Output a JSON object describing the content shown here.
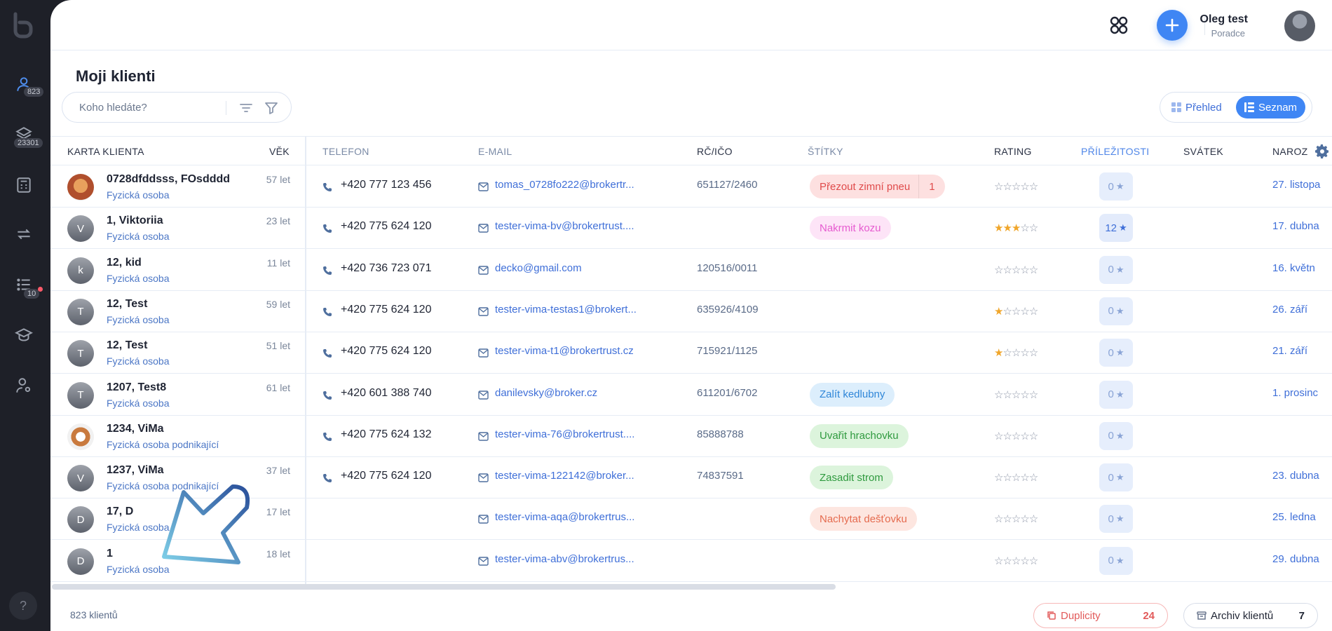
{
  "sidebar": {
    "clients_badge": "823",
    "products_badge": "23301",
    "tasks_badge": "10",
    "help_label": "?"
  },
  "topbar": {
    "user_name": "Oleg test",
    "user_role": "Poradce"
  },
  "page": {
    "title": "Moji klienti",
    "search_placeholder": "Koho hledáte?",
    "view_prehled": "Přehled",
    "view_seznam": "Seznam"
  },
  "columns": {
    "karta": "KARTA KLIENTA",
    "vek": "VĚK",
    "telefon": "TELEFON",
    "email": "E-MAIL",
    "rc": "RČ/IČO",
    "stitky": "ŠTÍTKY",
    "rating": "RATING",
    "prilezitosti": "PŘÍLEŽITOSTI",
    "svatek": "SVÁTEK",
    "narozeniny": "NAROZ"
  },
  "rows": [
    {
      "name": "0728dfddsss, FOsdddd",
      "type": "Fyzická osoba",
      "age": "57 let",
      "avatar": "",
      "phone": "+420 777 123 456",
      "email": "tomas_0728fo222@brokertr...",
      "rc": "651127/2460",
      "tag": "Přezout zimní pneu",
      "tag_extra": "1",
      "tag_bg": "#fde0e0",
      "tag_fg": "#e04b4b",
      "rating": 0,
      "opp": "0",
      "bday": "27. listopa"
    },
    {
      "name": "1, Viktoriia",
      "type": "Fyzická osoba",
      "age": "23 let",
      "avatar": "V",
      "phone": "+420 775 624 120",
      "email": "tester-vima-bv@brokertrust....",
      "rc": "",
      "tag": "Nakrmit kozu",
      "tag_extra": "",
      "tag_bg": "#fde4f7",
      "tag_fg": "#e65bd0",
      "rating": 3,
      "opp": "12",
      "bday": "17. dubna"
    },
    {
      "name": "12, kid",
      "type": "Fyzická osoba",
      "age": "11 let",
      "avatar": "k",
      "phone": "+420 736 723 071",
      "email": "decko@gmail.com",
      "rc": "120516/0011",
      "tag": "",
      "tag_extra": "",
      "tag_bg": "",
      "tag_fg": "",
      "rating": 0,
      "opp": "0",
      "bday": "16. květn"
    },
    {
      "name": "12, Test",
      "type": "Fyzická osoba",
      "age": "59 let",
      "avatar": "T",
      "phone": "+420 775 624 120",
      "email": "tester-vima-testas1@brokert...",
      "rc": "635926/4109",
      "tag": "",
      "tag_extra": "",
      "tag_bg": "",
      "tag_fg": "",
      "rating": 1,
      "opp": "0",
      "bday": "26. září"
    },
    {
      "name": "12, Test",
      "type": "Fyzická osoba",
      "age": "51 let",
      "avatar": "T",
      "phone": "+420 775 624 120",
      "email": "tester-vima-t1@brokertrust.cz",
      "rc": "715921/1125",
      "tag": "",
      "tag_extra": "",
      "tag_bg": "",
      "tag_fg": "",
      "rating": 1,
      "opp": "0",
      "bday": "21. září"
    },
    {
      "name": "1207, Test8",
      "type": "Fyzická osoba",
      "age": "61 let",
      "avatar": "T",
      "phone": "+420 601 388 740",
      "email": "danilevsky@broker.cz",
      "rc": "611201/6702",
      "tag": "Zalít kedlubny",
      "tag_extra": "",
      "tag_bg": "#dceefc",
      "tag_fg": "#2f86d8",
      "rating": 0,
      "opp": "0",
      "bday": "1. prosinc"
    },
    {
      "name": "1234, ViMa",
      "type": "Fyzická osoba podnikající",
      "age": "",
      "avatar": "",
      "phone": "+420 775 624 132",
      "email": "tester-vima-76@brokertrust....",
      "rc": "85888788",
      "tag": "Uvařit hrachovku",
      "tag_extra": "",
      "tag_bg": "#dcf4dc",
      "tag_fg": "#2f9a3f",
      "rating": 0,
      "opp": "0",
      "bday": ""
    },
    {
      "name": "1237, ViMa",
      "type": "Fyzická osoba podnikající",
      "age": "37 let",
      "avatar": "V",
      "phone": "+420 775 624 120",
      "email": "tester-vima-122142@broker...",
      "rc": "74837591",
      "tag": "Zasadit strom",
      "tag_extra": "",
      "tag_bg": "#dcf4dc",
      "tag_fg": "#2f9a3f",
      "rating": 0,
      "opp": "0",
      "bday": "23. dubna"
    },
    {
      "name": "17, D",
      "type": "Fyzická osoba",
      "age": "17 let",
      "avatar": "D",
      "phone": "",
      "email": "tester-vima-aqa@brokertrus...",
      "rc": "",
      "tag": "Nachytat dešťovku",
      "tag_extra": "",
      "tag_bg": "#fde6e0",
      "tag_fg": "#e56b4f",
      "rating": 0,
      "opp": "0",
      "bday": "25. ledna"
    },
    {
      "name": "1",
      "type": "Fyzická osoba",
      "age": "18 let",
      "avatar": "D",
      "phone": "",
      "email": "tester-vima-abv@brokertrus...",
      "rc": "",
      "tag": "",
      "tag_extra": "",
      "tag_bg": "",
      "tag_fg": "",
      "rating": 0,
      "opp": "0",
      "bday": "29. dubna"
    }
  ],
  "footer": {
    "count": "823 klientů",
    "duplicity_label": "Duplicity",
    "duplicity_count": "24",
    "archive_label": "Archiv klientů",
    "archive_count": "7"
  },
  "colors": {
    "accent": "#3f86f4",
    "sidebar": "#1e2028"
  }
}
